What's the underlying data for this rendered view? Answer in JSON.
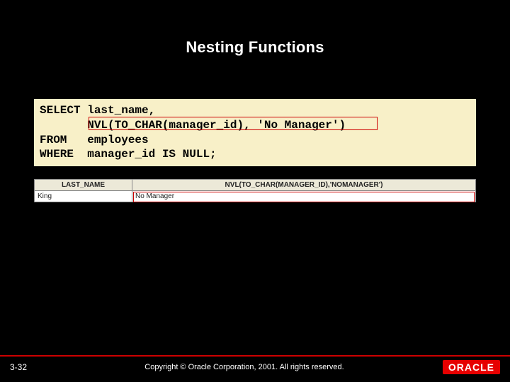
{
  "title": "Nesting Functions",
  "code": "SELECT last_name,\n       NVL(TO_CHAR(manager_id), 'No Manager')\nFROM   employees\nWHERE  manager_id IS NULL;",
  "result": {
    "header": {
      "col1": "LAST_NAME",
      "col2": "NVL(TO_CHAR(MANAGER_ID),'NOMANAGER')"
    },
    "row": {
      "col1": "King",
      "col2": "No Manager"
    }
  },
  "footer": {
    "slide_num": "3-32",
    "copyright": "Copyright © Oracle Corporation, 2001. All rights reserved.",
    "logo_text": "ORACLE"
  }
}
